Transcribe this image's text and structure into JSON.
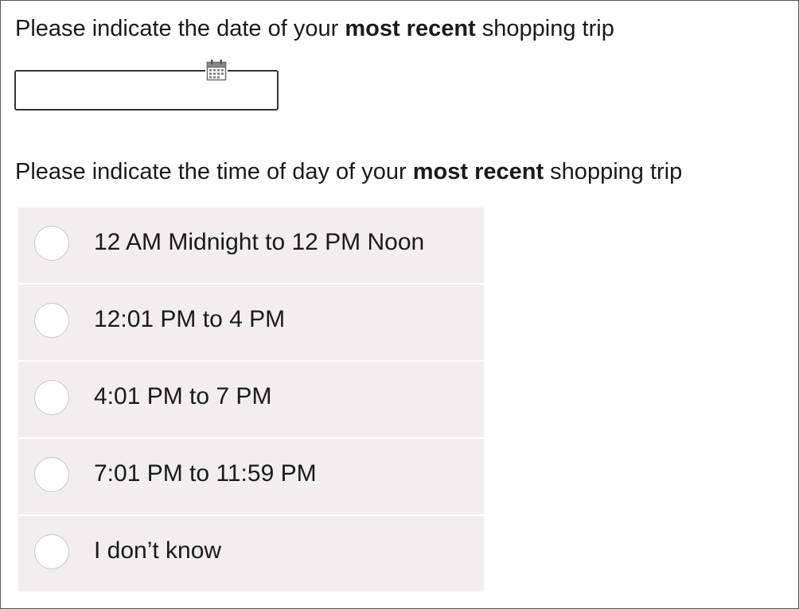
{
  "q1": {
    "text_before": "Please indicate the date of your ",
    "text_bold": "most recent",
    "text_after": " shopping trip"
  },
  "date_input": {
    "value": ""
  },
  "q2": {
    "text_before": "Please indicate the time of day of your ",
    "text_bold": "most recent",
    "text_after": " shopping trip"
  },
  "options": [
    {
      "label": "12 AM Midnight to 12 PM Noon"
    },
    {
      "label": "12:01 PM to 4 PM"
    },
    {
      "label": "4:01 PM to 7 PM"
    },
    {
      "label": "7:01 PM to 11:59 PM"
    },
    {
      "label": "I don’t know"
    }
  ],
  "icons": {
    "calendar": "calendar-icon",
    "radio": "radio-button"
  }
}
